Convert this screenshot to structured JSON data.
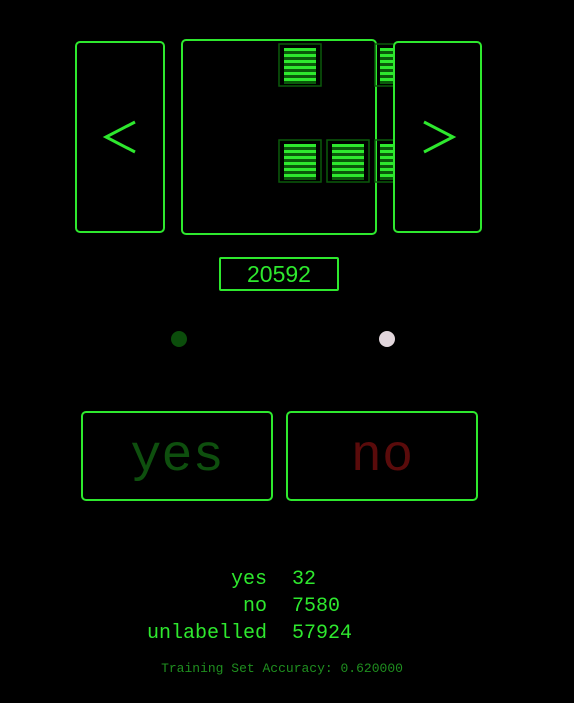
{
  "colors": {
    "accent": "#2ee82e",
    "yes_text": "#0e4f0e",
    "no_text": "#5a0b0b",
    "block_dark": "#0a5a0a",
    "block_bright": "#2ee82e",
    "dot_yes": "#0b4d0b",
    "dot_no": "#e2d6dc",
    "accuracy_text": "#1f8f1f"
  },
  "navigation": {
    "prev_icon": "chevron-left-icon",
    "next_icon": "chevron-right-icon"
  },
  "sample_image": {
    "grid": [
      [
        0,
        1,
        0,
        1
      ],
      [
        0,
        0,
        0,
        0
      ],
      [
        0,
        1,
        1,
        1
      ]
    ]
  },
  "counter": {
    "value": "20592"
  },
  "indicators": {
    "yes_dot": "status-dot",
    "no_dot": "status-dot"
  },
  "buttons": {
    "yes_label": "yes",
    "no_label": "no"
  },
  "stats": [
    {
      "key": "yes",
      "value": "32"
    },
    {
      "key": "no",
      "value": "7580"
    },
    {
      "key": "unlabelled",
      "value": "57924"
    }
  ],
  "accuracy": {
    "text": "Training Set Accuracy: 0.620000"
  }
}
